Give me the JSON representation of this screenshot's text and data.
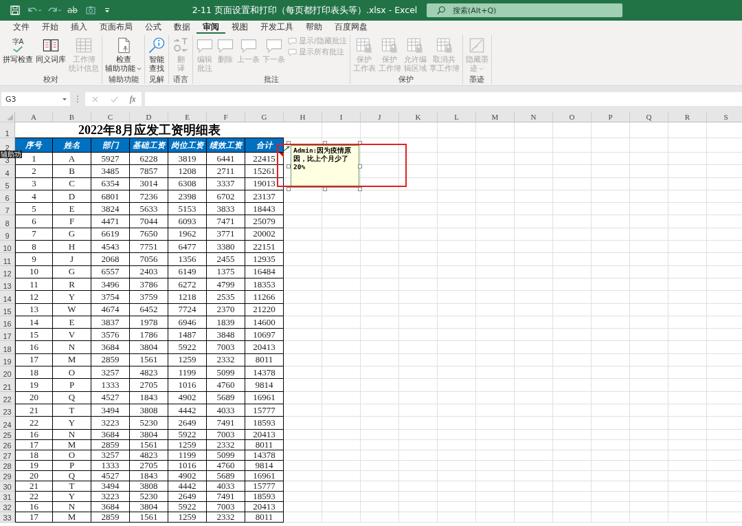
{
  "window": {
    "title": "2-11 页面设置和打印（每页都打印表头等）.xlsx  -  Excel",
    "quick_access": {
      "format_text": "ab"
    },
    "search": {
      "placeholder": "搜索(Alt+Q)"
    }
  },
  "tabs": [
    {
      "label": "文件",
      "selected": false
    },
    {
      "label": "开始",
      "selected": false
    },
    {
      "label": "插入",
      "selected": false
    },
    {
      "label": "页面布局",
      "selected": false
    },
    {
      "label": "公式",
      "selected": false
    },
    {
      "label": "数据",
      "selected": false
    },
    {
      "label": "审阅",
      "selected": true
    },
    {
      "label": "视图",
      "selected": false
    },
    {
      "label": "开发工具",
      "selected": false
    },
    {
      "label": "帮助",
      "selected": false
    },
    {
      "label": "百度网盘",
      "selected": false
    }
  ],
  "ribbon": [
    {
      "label": "校对",
      "buttons": [
        {
          "lines": [
            "拼写检查"
          ],
          "icon_text": "字A",
          "disabled": false,
          "dropdown": false
        },
        {
          "lines": [
            "同义词库"
          ],
          "disabled": false,
          "dropdown": false
        },
        {
          "lines": [
            "工作簿",
            "统计信息"
          ],
          "disabled": true,
          "dropdown": false
        }
      ]
    },
    {
      "label": "辅助功能",
      "buttons": [
        {
          "lines": [
            "检查",
            "辅助功能"
          ],
          "disabled": false,
          "dropdown": true
        }
      ]
    },
    {
      "label": "见解",
      "buttons": [
        {
          "lines": [
            "智能",
            "查找"
          ],
          "disabled": false,
          "dropdown": false
        }
      ]
    },
    {
      "label": "语言",
      "buttons": [
        {
          "lines": [
            "翻",
            "译"
          ],
          "disabled": true,
          "dropdown": false
        }
      ]
    },
    {
      "label": "批注",
      "buttons": [
        {
          "lines": [
            "编辑",
            "批注"
          ],
          "disabled": true,
          "dropdown": false
        },
        {
          "lines": [
            "删除"
          ],
          "disabled": true,
          "dropdown": false
        },
        {
          "lines": [
            "上一条"
          ],
          "disabled": true,
          "dropdown": false
        },
        {
          "lines": [
            "下一条"
          ],
          "disabled": true,
          "dropdown": false
        }
      ],
      "small_buttons": [
        {
          "label": "显示/隐藏批注",
          "disabled": true
        },
        {
          "label": "显示所有批注",
          "disabled": true
        }
      ]
    },
    {
      "label": "保护",
      "buttons": [
        {
          "lines": [
            "保护",
            "工作表"
          ],
          "disabled": true,
          "dropdown": false
        },
        {
          "lines": [
            "保护",
            "工作簿"
          ],
          "disabled": true,
          "dropdown": false
        },
        {
          "lines": [
            "允许编",
            "辑区域"
          ],
          "disabled": true,
          "dropdown": false
        },
        {
          "lines": [
            "取消共",
            "享工作簿"
          ],
          "disabled": true,
          "dropdown": false
        }
      ]
    },
    {
      "label": "墨迹",
      "buttons": [
        {
          "lines": [
            "隐藏墨",
            "迹"
          ],
          "disabled": true,
          "dropdown": true
        }
      ]
    }
  ],
  "formula_bar": {
    "name_box": "G3",
    "function_label": "fx"
  },
  "row_numbers": [
    "1",
    "2",
    "3",
    "4",
    "5",
    "6",
    "7",
    "8",
    "9",
    "10",
    "11",
    "12",
    "13",
    "14",
    "15",
    "16",
    "17",
    "18",
    "19",
    "20",
    "21",
    "22",
    "23",
    "24",
    "25",
    "26",
    "27",
    "28",
    "29",
    "30",
    "31",
    "32",
    "33"
  ],
  "columns": [
    "A",
    "B",
    "C",
    "D",
    "E",
    "F",
    "G",
    "H",
    "I",
    "J",
    "K",
    "L",
    "M",
    "N",
    "O",
    "P",
    "Q",
    "R",
    "S"
  ],
  "sheet": {
    "title": "2022年8月应发工资明细表",
    "header": [
      "序号",
      "姓名",
      "部门",
      "基础工资",
      "岗位工资",
      "绩效工资",
      "合计"
    ],
    "rows": [
      [
        "1",
        "A",
        "5927",
        "6228",
        "3819",
        "6441",
        "22415"
      ],
      [
        "2",
        "B",
        "3485",
        "7857",
        "1208",
        "2711",
        "15261"
      ],
      [
        "3",
        "C",
        "6354",
        "3014",
        "6308",
        "3337",
        "19013"
      ],
      [
        "4",
        "D",
        "6801",
        "7236",
        "2398",
        "6702",
        "23137"
      ],
      [
        "5",
        "E",
        "3824",
        "5633",
        "5153",
        "3833",
        "18443"
      ],
      [
        "6",
        "F",
        "4471",
        "7044",
        "6093",
        "7471",
        "25079"
      ],
      [
        "7",
        "G",
        "6619",
        "7650",
        "1962",
        "3771",
        "20002"
      ],
      [
        "8",
        "H",
        "4543",
        "7751",
        "6477",
        "3380",
        "22151"
      ],
      [
        "9",
        "J",
        "2068",
        "7056",
        "1356",
        "2455",
        "12935"
      ],
      [
        "10",
        "G",
        "6557",
        "2403",
        "6149",
        "1375",
        "16484"
      ],
      [
        "11",
        "R",
        "3496",
        "3786",
        "6272",
        "4799",
        "18353"
      ],
      [
        "12",
        "Y",
        "3754",
        "3759",
        "1218",
        "2535",
        "11266"
      ],
      [
        "13",
        "W",
        "4674",
        "6452",
        "7724",
        "2370",
        "21220"
      ],
      [
        "14",
        "E",
        "3837",
        "1978",
        "6946",
        "1839",
        "14600"
      ],
      [
        "15",
        "V",
        "3576",
        "1786",
        "1487",
        "3848",
        "10697"
      ],
      [
        "16",
        "N",
        "3684",
        "3804",
        "5922",
        "7003",
        "20413"
      ],
      [
        "17",
        "M",
        "2859",
        "1561",
        "1259",
        "2332",
        "8011"
      ],
      [
        "18",
        "O",
        "3257",
        "4823",
        "1199",
        "5099",
        "14378"
      ],
      [
        "19",
        "P",
        "1333",
        "2705",
        "1016",
        "4760",
        "9814"
      ],
      [
        "20",
        "Q",
        "4527",
        "1843",
        "4902",
        "5689",
        "16961"
      ],
      [
        "21",
        "T",
        "3494",
        "3808",
        "4442",
        "4033",
        "15777"
      ],
      [
        "22",
        "Y",
        "3223",
        "5230",
        "2649",
        "7491",
        "18593"
      ],
      [
        "16",
        "N",
        "3684",
        "3804",
        "5922",
        "7003",
        "20413"
      ],
      [
        "17",
        "M",
        "2859",
        "1561",
        "1259",
        "2332",
        "8011"
      ],
      [
        "18",
        "O",
        "3257",
        "4823",
        "1199",
        "5099",
        "14378"
      ],
      [
        "19",
        "P",
        "1333",
        "2705",
        "1016",
        "4760",
        "9814"
      ],
      [
        "20",
        "Q",
        "4527",
        "1843",
        "4902",
        "5689",
        "16961"
      ],
      [
        "21",
        "T",
        "3494",
        "3808",
        "4442",
        "4033",
        "15777"
      ],
      [
        "22",
        "Y",
        "3223",
        "5230",
        "2649",
        "7491",
        "18593"
      ],
      [
        "16",
        "N",
        "3684",
        "3804",
        "5922",
        "7003",
        "20413"
      ],
      [
        "17",
        "M",
        "2859",
        "1561",
        "1259",
        "2332",
        "8011"
      ]
    ]
  },
  "comment": {
    "author": "Admin:",
    "text": "因为疫情原因，比上个月少了20%"
  },
  "tooltip": "辅助功"
}
